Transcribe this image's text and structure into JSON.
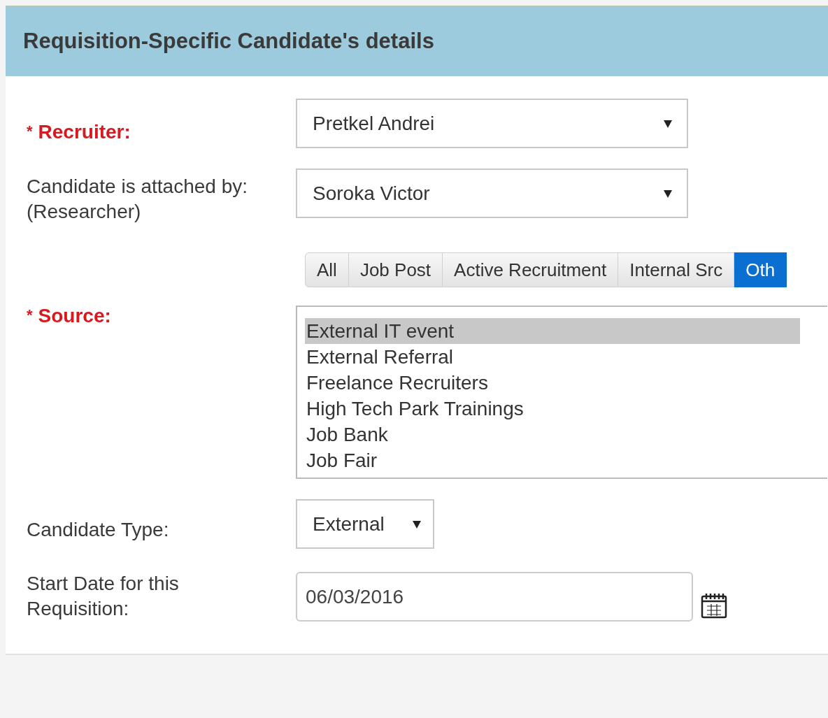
{
  "panel": {
    "title": "Requisition-Specific Candidate's details"
  },
  "fields": [
    {
      "kind": "select",
      "mark": "*",
      "label": "Recruiter:",
      "required": true,
      "value": "Pretkel Andrei"
    },
    {
      "kind": "select",
      "label": "Candidate is attached by:\n(Researcher)",
      "required": false,
      "value": "Soroka Victor"
    },
    {
      "kind": "sources",
      "mark": "*",
      "label": "Source:",
      "required": true,
      "tabs": [
        {
          "label": "All",
          "selected": false
        },
        {
          "label": "Job Post",
          "selected": false
        },
        {
          "label": "Active Recruitment",
          "selected": false
        },
        {
          "label": "Internal Src",
          "selected": false
        },
        {
          "label": "Oth",
          "selected": true
        }
      ],
      "options": [
        {
          "label": "External IT event",
          "selected": true
        },
        {
          "label": "External Referral",
          "selected": false
        },
        {
          "label": "Freelance Recruiters",
          "selected": false
        },
        {
          "label": "High Tech Park Trainings",
          "selected": false
        },
        {
          "label": "Job Bank",
          "selected": false
        },
        {
          "label": "Job Fair",
          "selected": false
        }
      ]
    },
    {
      "kind": "short-select",
      "label": "Candidate Type:",
      "required": false,
      "value": "External"
    },
    {
      "kind": "date",
      "label": "Start Date for this\nRequisition:",
      "required": false,
      "value": "06/03/2016"
    }
  ]
}
